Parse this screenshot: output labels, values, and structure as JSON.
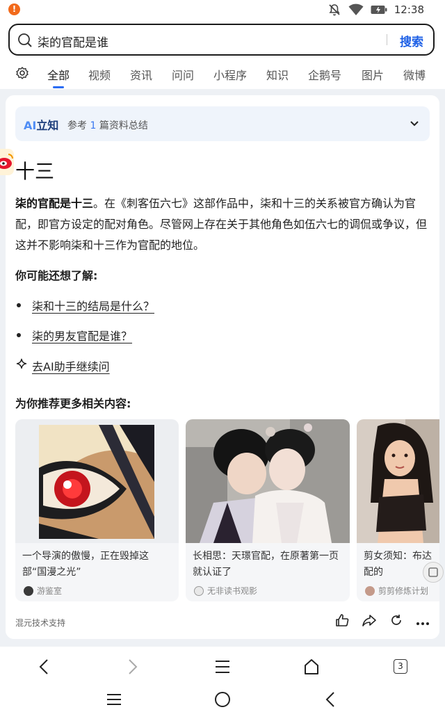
{
  "status_bar": {
    "time": "12:38",
    "icons": [
      "alert-icon",
      "bell-off-icon",
      "wifi-icon",
      "battery-icon"
    ]
  },
  "search": {
    "query": "柒的官配是谁",
    "button_label": "搜索"
  },
  "tabs": [
    "全部",
    "视频",
    "资讯",
    "问问",
    "小程序",
    "知识",
    "企鹅号",
    "图片",
    "微博"
  ],
  "ai_summary": {
    "logo_ai": "AI",
    "logo_text": "立知",
    "ref_prefix": "参考",
    "ref_count": "1",
    "ref_suffix": "篇资料总结"
  },
  "answer": {
    "title": "十三",
    "bold_lead": "柒的官配是十三",
    "body": "。在《刺客伍六七》这部作品中，柒和十三的关系被官方确认为官配，即官方设定的配对角色。尽管网上存在关于其他角色如伍六七的调侃或争议，但这并不影响柒和十三作为官配的地位。"
  },
  "maybe": {
    "title": "你可能还想了解:",
    "questions": [
      "柒和十三的结局是什么？",
      "柒的男友官配是谁？"
    ],
    "ai_continue": "去AI助手继续问"
  },
  "recommend": {
    "title": "为你推荐更多相关内容:",
    "cards": [
      {
        "text": "一个导演的傲慢，正在毁掉这部“国漫之光”",
        "source": "游鉴室"
      },
      {
        "text": "长相思：天璟官配，在原著第一页就认证了",
        "source": "无非读书观影"
      },
      {
        "text": "剪女须知：布达配的",
        "source": "剪剪修炼计划"
      }
    ]
  },
  "footer": {
    "note": "混元技术支持"
  },
  "browser_bar": {
    "tab_count": "3"
  },
  "colors": {
    "accent": "#1e60e6",
    "tab_indicator": "#2a6cf3",
    "alert": "#f26a1b"
  }
}
